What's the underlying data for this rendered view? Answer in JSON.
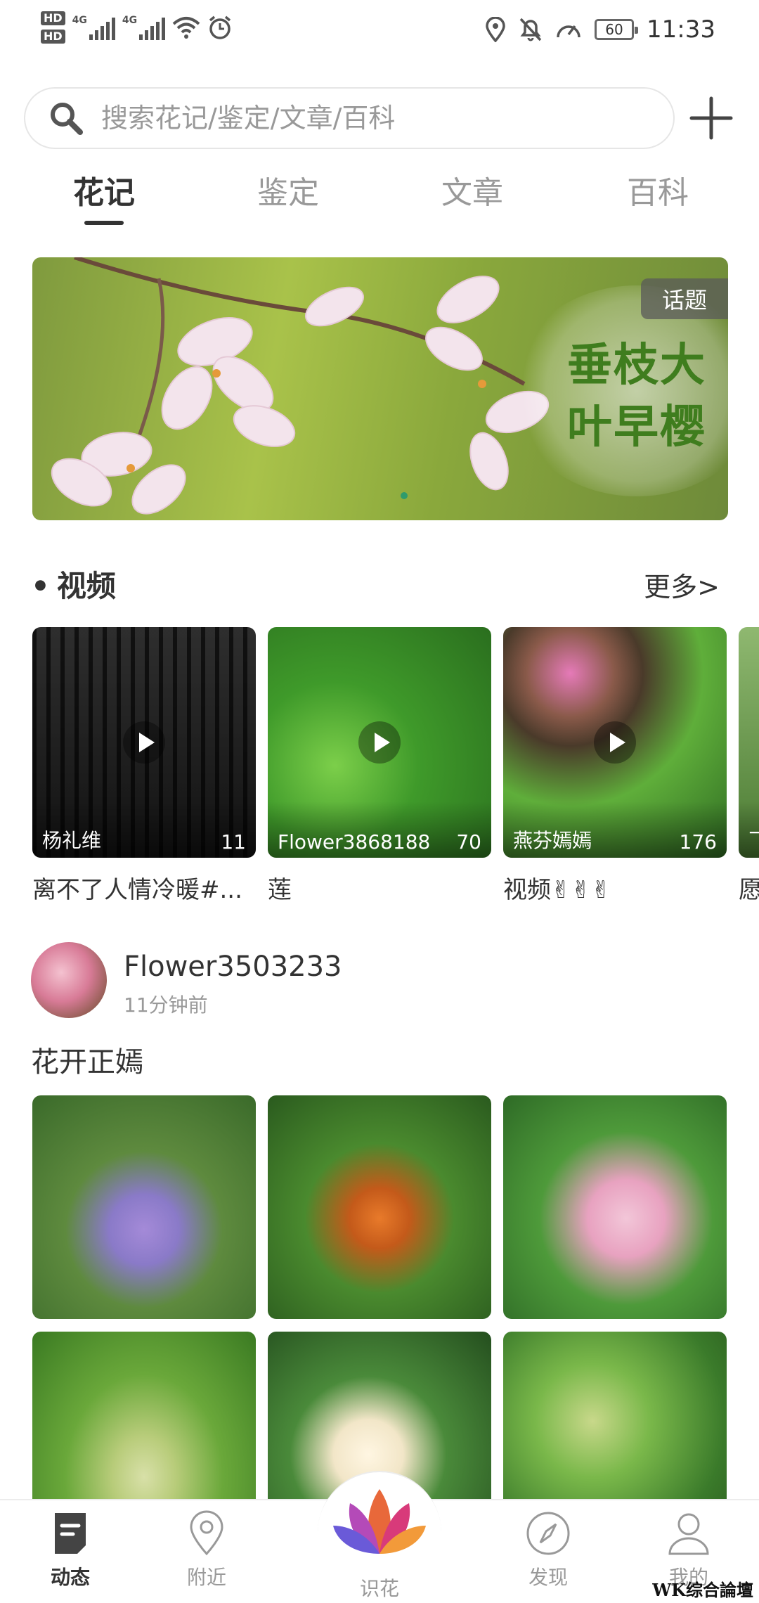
{
  "status_bar": {
    "hd1": "HD",
    "hd2": "HD",
    "net1": "4G",
    "net2": "4G",
    "battery": "60",
    "time": "11:33"
  },
  "search": {
    "placeholder": "搜索花记/鉴定/文章/百科"
  },
  "tabs": [
    {
      "label": "花记",
      "active": true
    },
    {
      "label": "鉴定",
      "active": false
    },
    {
      "label": "文章",
      "active": false
    },
    {
      "label": "百科",
      "active": false
    }
  ],
  "banner": {
    "tag": "话题",
    "title": "垂枝大叶早樱"
  },
  "video_section": {
    "title": "视频",
    "more": "更多>"
  },
  "videos": [
    {
      "user": "杨礼维",
      "count": "11",
      "title": "离不了人情冷暖#..."
    },
    {
      "user": "Flower3868188",
      "count": "70",
      "title": "莲"
    },
    {
      "user": "燕芬嫣嫣",
      "count": "176",
      "title": "视频✌✌✌"
    },
    {
      "user": "飞",
      "count": "",
      "title": "愿"
    }
  ],
  "post": {
    "user": "Flower3503233",
    "time": "11分钟前",
    "text": "花开正嫣"
  },
  "bottom_nav": [
    {
      "label": "动态",
      "icon": "doc-icon",
      "active": true
    },
    {
      "label": "附近",
      "icon": "location-icon",
      "active": false
    },
    {
      "label": "识花",
      "icon": "lotus-icon",
      "active": false
    },
    {
      "label": "发现",
      "icon": "compass-icon",
      "active": false
    },
    {
      "label": "我的",
      "icon": "person-icon",
      "active": false
    }
  ],
  "watermark": "WK综合論壇"
}
